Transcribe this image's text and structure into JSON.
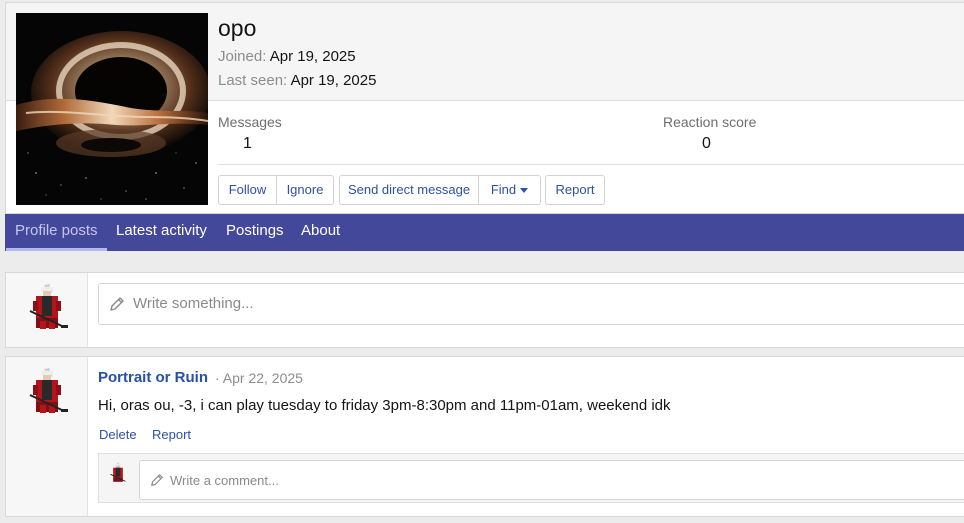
{
  "profile": {
    "username": "opo",
    "joined_label": "Joined:",
    "joined_value": "Apr 19, 2025",
    "last_seen_label": "Last seen:",
    "last_seen_value": "Apr 19, 2025",
    "stats": {
      "messages_label": "Messages",
      "messages_value": "1",
      "reaction_label": "Reaction score",
      "reaction_value": "0"
    },
    "buttons": {
      "follow": "Follow",
      "ignore": "Ignore",
      "send_dm": "Send direct message",
      "find": "Find",
      "report": "Report"
    }
  },
  "tabs": [
    {
      "label": "Profile posts",
      "active": true
    },
    {
      "label": "Latest activity",
      "active": false
    },
    {
      "label": "Postings",
      "active": false
    },
    {
      "label": "About",
      "active": false
    }
  ],
  "composer": {
    "placeholder": "Write something..."
  },
  "post": {
    "author": "Portrait or Ruin",
    "date": "· Apr 22, 2025",
    "text": "Hi, oras ou, -3, i can play tuesday to friday 3pm-8:30pm and 11pm-01am, weekend idk",
    "actions": {
      "delete": "Delete",
      "report": "Report"
    },
    "comment_placeholder": "Write a comment..."
  },
  "icons": {
    "pencil": "pencil-icon",
    "caret": "chevron-down-icon"
  },
  "colors": {
    "tab_bar": "#44489a",
    "link": "#2b52a6",
    "poster_link": "#2551a8"
  }
}
